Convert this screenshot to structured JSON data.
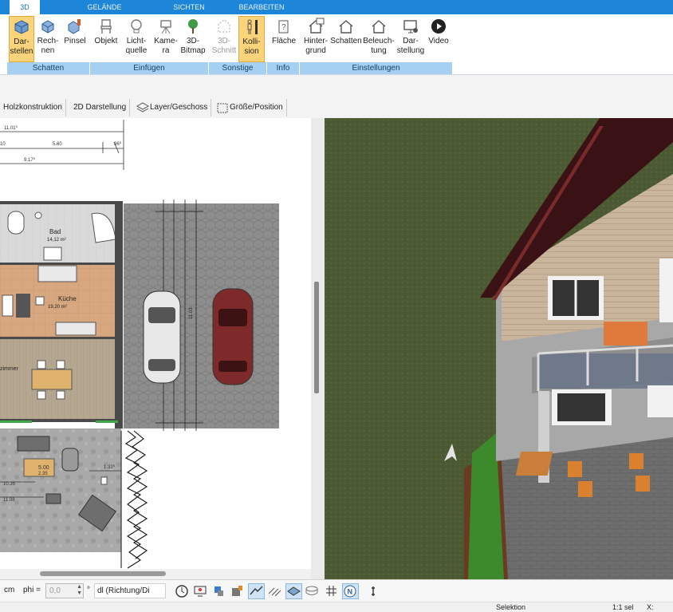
{
  "tabs": [
    {
      "label": "3D",
      "active": true
    },
    {
      "label": "GELÄNDE",
      "active": false
    },
    {
      "label": "SICHTEN",
      "active": false
    },
    {
      "label": "BEARBEITEN",
      "active": false
    }
  ],
  "ribbon": {
    "buttons": {
      "darstellen": "Dar-\nstellen",
      "rechnen": "Rech-\nnen",
      "pinsel": "Pinsel",
      "objekt": "Objekt",
      "lichtquelle": "Licht-\nquelle",
      "kamera": "Kame-\nra",
      "bitmap3d": "3D-\nBitmap",
      "schnitt3d": "3D-\nSchnitt",
      "kollision": "Kolli-\nsion",
      "flaeche": "Fläche",
      "hintergrund": "Hinter-\ngrund",
      "schatten": "Schatten",
      "beleuchtung": "Beleuch-\ntung",
      "darstellung": "Dar-\nstellung",
      "video": "Video"
    },
    "groups": {
      "schatten": "Schatten",
      "einfuegen": "Einfügen",
      "sonstige": "Sonstige",
      "info": "Info",
      "einstellungen": "Einstellungen"
    }
  },
  "toolbar2": {
    "holzkonstruktion": "Holzkonstruktion",
    "darstellung2d": "2D Darstellung",
    "layer": "Layer/Geschoss",
    "groesse": "Größe/Position"
  },
  "plan": {
    "dims": {
      "top1": "11.01",
      "top1_sup": "5",
      "d_10": "10",
      "d_560": "5.60",
      "d_36": "36",
      "d_36_sup": "5",
      "d_917": "9.17",
      "d_917_sup": "5",
      "d_1035": "10.35",
      "d_1108": "11.08",
      "d_132": "1.32",
      "d_132_sup": "5",
      "d_1103": "11.03",
      "d_500": "5.00",
      "d_235": "2.35"
    },
    "rooms": {
      "bad": "Bad",
      "bad_area": "14,12 m²",
      "kueche": "Küche",
      "kueche_area": "19,20 m²",
      "zimmer": "zimmer"
    }
  },
  "bottombar": {
    "unit": "cm",
    "phi_label": "phi =",
    "phi_value": "0,0",
    "degree": "°",
    "direction_select": "dl (Richtung/Di"
  },
  "statusbar": {
    "mode": "Selektion",
    "scale": "1:1 sel",
    "x_label": "X:"
  },
  "icons": [
    "cube-icon",
    "cube-calc-icon",
    "paint-brush-icon",
    "chair-icon",
    "bulb-icon",
    "camera-icon",
    "tree-icon",
    "section-icon",
    "collision-icon",
    "area-info-icon",
    "house-background-icon",
    "house-shadow-icon",
    "house-light-icon",
    "monitor-icon",
    "play-icon",
    "clock-icon",
    "north-icon"
  ],
  "colors": {
    "tabbar": "#1e86d8",
    "active_button": "#fbd37a",
    "group_bar": "#a6d0f2",
    "grass": "#4b5a33",
    "roof": "#3a1216"
  }
}
